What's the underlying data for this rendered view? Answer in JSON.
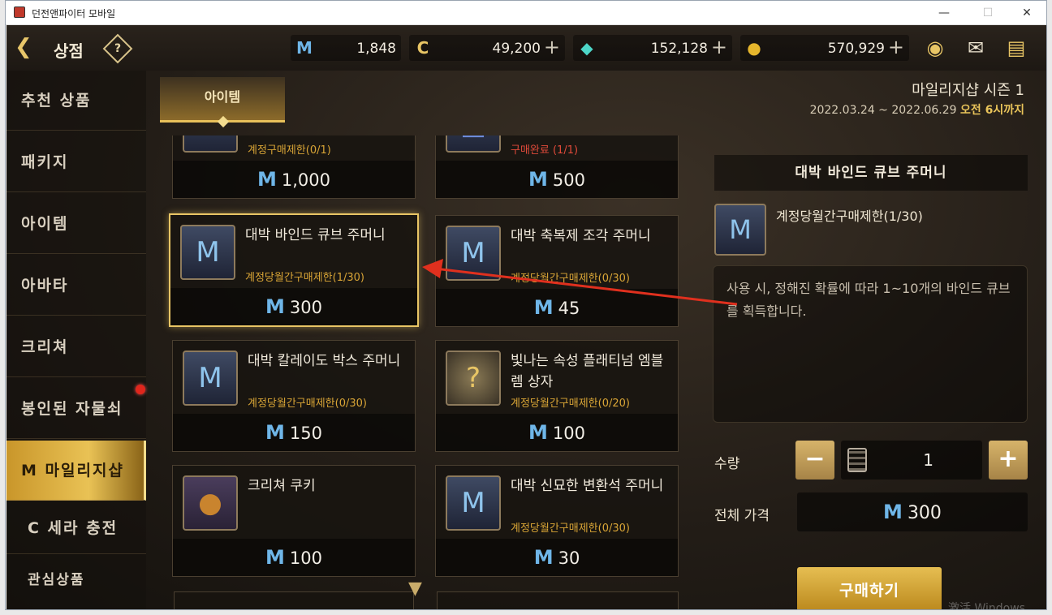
{
  "window": {
    "title": "던전앤파이터 모바일",
    "min": "—",
    "max": "☐",
    "close": "✕"
  },
  "header": {
    "back_icon": "back-arrow-icon",
    "title": "상점",
    "help": "?",
    "currencies": [
      {
        "icon": "M",
        "value": "1,848",
        "plus": ""
      },
      {
        "icon": "C",
        "value": "49,200",
        "plus": "+"
      },
      {
        "icon": "◆",
        "value": "152,128",
        "plus": "+"
      },
      {
        "icon": "●",
        "value": "570,929",
        "plus": "+"
      }
    ]
  },
  "sidebar": {
    "items": [
      {
        "label": "추천 상품"
      },
      {
        "label": "패키지"
      },
      {
        "label": "아이템"
      },
      {
        "label": "아바타"
      },
      {
        "label": "크리쳐"
      },
      {
        "label": "봉인된 자물쇠"
      },
      {
        "label": "M 마일리지샵"
      },
      {
        "label": "C 세라 충전"
      },
      {
        "label": "관심상품"
      }
    ]
  },
  "tab": {
    "label": "아이템"
  },
  "items": [
    {
      "name": "",
      "limit": "계정구매제한(0/1)",
      "price": "1,000",
      "icon": "9",
      "red": false
    },
    {
      "name": "",
      "limit": "구매완료 (1/1)",
      "price": "500",
      "icon": "▣",
      "red": true
    },
    {
      "name": "대박 바인드 큐브 주머니",
      "limit": "계정당월간구매제한(1/30)",
      "price": "300",
      "icon": "M",
      "red": false
    },
    {
      "name": "대박 축복제 조각 주머니",
      "limit": "계정당월간구매제한(0/30)",
      "price": "45",
      "icon": "M",
      "red": false
    },
    {
      "name": "대박 칼레이도 박스 주머니",
      "limit": "계정당월간구매제한(0/30)",
      "price": "150",
      "icon": "M",
      "red": false
    },
    {
      "name": "빛나는 속성 플래티넘 엠블렘 상자",
      "limit": "계정당월간구매제한(0/20)",
      "price": "100",
      "icon": "?",
      "red": false
    },
    {
      "name": "크리쳐 쿠키",
      "limit": "",
      "price": "100",
      "icon": "●",
      "red": false
    },
    {
      "name": "대박 신묘한 변환석 주머니",
      "limit": "계정당월간구매제한(0/30)",
      "price": "30",
      "icon": "M",
      "red": false
    }
  ],
  "detail": {
    "season": "마일리지샵 시즌 1",
    "dates": "2022.03.24 ~ 2022.06.29",
    "dates_suffix": "오전 6시까지",
    "title": "대박 바인드 큐브 주머니",
    "limit": "계정당월간구매제한(1/30)",
    "description": "사용 시, 정해진 확률에 따라 1~10개의 바인드 큐브를 획득합니다.",
    "qty_label": "수량",
    "qty": "1",
    "minus": "−",
    "plus": "+",
    "total_label": "전체 가격",
    "total": "300",
    "buy_label": "구매하기"
  },
  "watermark": "激活 Windows",
  "colors": {
    "accent": "#e8c565",
    "mileage": "#6fb6e8",
    "limit": "#d9a536",
    "annotation_arrow": "#e0301e"
  }
}
